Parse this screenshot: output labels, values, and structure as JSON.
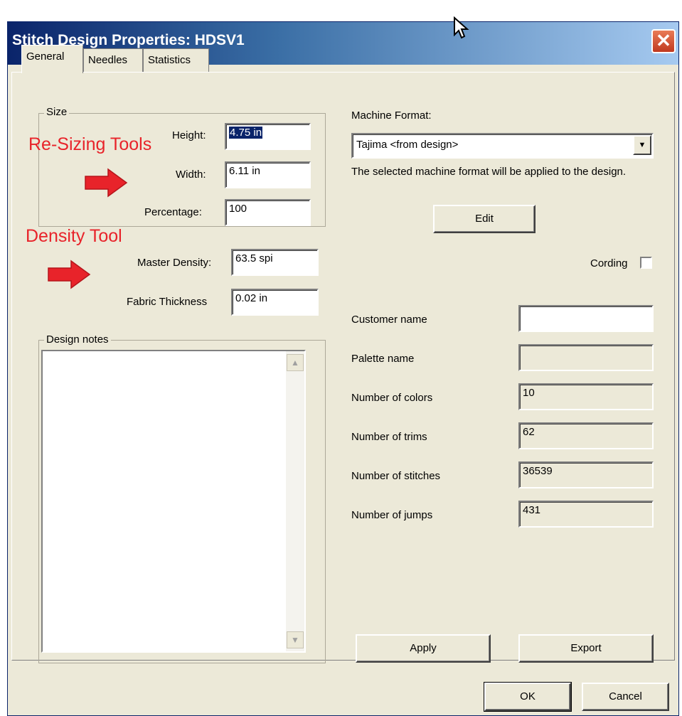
{
  "window": {
    "title": "Stitch Design Properties: HDSV1",
    "close_glyph": "✕"
  },
  "tabs": [
    {
      "label": "General"
    },
    {
      "label": "Needles"
    },
    {
      "label": "Statistics"
    }
  ],
  "size_group": {
    "label": "Size",
    "height_label": "Height:",
    "height_value": "4.75 in",
    "width_label": "Width:",
    "width_value": "6.11 in",
    "percentage_label": "Percentage:",
    "percentage_value": "100"
  },
  "density": {
    "master_label": "Master Density:",
    "master_value": "63.5 spi",
    "thickness_label": "Fabric Thickness",
    "thickness_value": "0.02 in"
  },
  "notes": {
    "label": "Design notes",
    "value": ""
  },
  "machine": {
    "label": "Machine Format:",
    "selected": "Tajima <from design>",
    "description": "The selected machine format will be applied to the design.",
    "edit_label": "Edit"
  },
  "cording": {
    "label": "Cording",
    "checked": false
  },
  "info": {
    "customer_label": "Customer name",
    "customer_value": "",
    "palette_label": "Palette name",
    "palette_value": "",
    "colors_label": "Number of colors",
    "colors_value": "10",
    "trims_label": "Number of trims",
    "trims_value": "62",
    "stitches_label": "Number of stitches",
    "stitches_value": "36539",
    "jumps_label": "Number of jumps",
    "jumps_value": "431"
  },
  "buttons": {
    "apply": "Apply",
    "export": "Export",
    "ok": "OK",
    "cancel": "Cancel"
  },
  "annotations": {
    "resizing": "Re-Sizing Tools",
    "density": "Density Tool"
  },
  "colors": {
    "annotation": "#e8232a",
    "titlebar": "#0a246a",
    "dialog_bg": "#ece9d8"
  }
}
